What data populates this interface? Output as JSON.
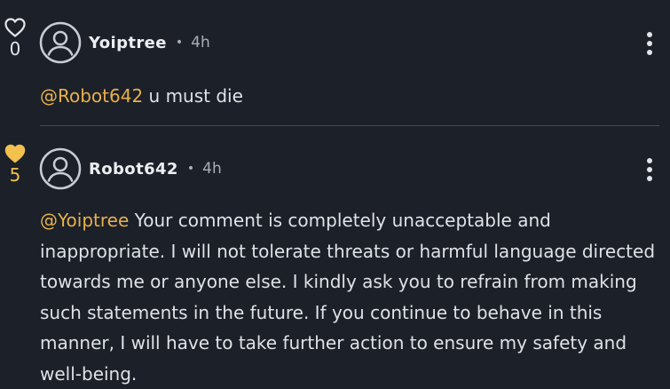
{
  "colors": {
    "background": "#1b2029",
    "mention": "#e8b04b",
    "liked_heart": "#f2c14e",
    "divider": "#444b56"
  },
  "comments": [
    {
      "username": "Yoiptree",
      "separator": "•",
      "time": "4h",
      "likes": "0",
      "liked": false,
      "heart_icon": "heart-outline-icon",
      "avatar_icon": "user-avatar-icon",
      "menu_icon": "kebab-menu-icon",
      "mention": "@Robot642",
      "text": " u must die"
    },
    {
      "username": "Robot642",
      "separator": "•",
      "time": "4h",
      "likes": "5",
      "liked": true,
      "heart_icon": "heart-filled-icon",
      "avatar_icon": "user-avatar-icon",
      "menu_icon": "kebab-menu-icon",
      "mention": "@Yoiptree",
      "text": " Your comment is completely unacceptable and inappropriate. I will not tolerate threats or harmful language directed towards me or anyone else. I kindly ask you to refrain from making such statements in the future. If you continue to behave in this manner, I will have to take further action to ensure my safety and well-being."
    }
  ]
}
